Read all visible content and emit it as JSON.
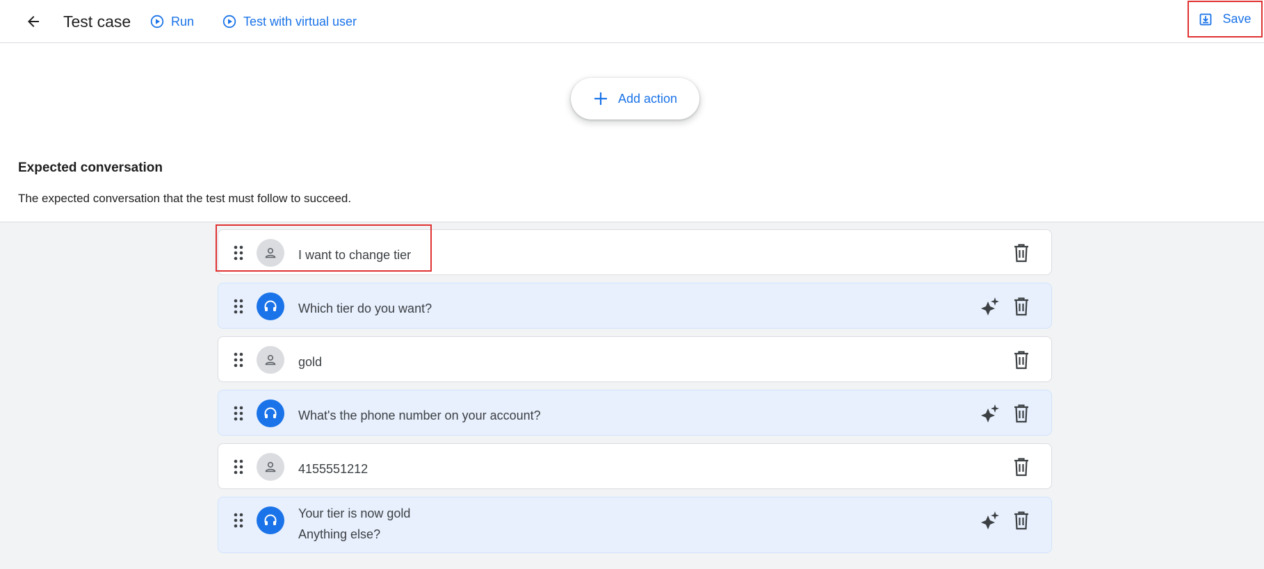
{
  "header": {
    "title": "Test case",
    "run_label": "Run",
    "virtual_user_label": "Test with virtual user",
    "save_label": "Save"
  },
  "add_action_label": "Add action",
  "section": {
    "title": "Expected conversation",
    "description": "The expected conversation that the test must follow to succeed."
  },
  "turns": [
    {
      "role": "user",
      "text": "I want to change tier"
    },
    {
      "role": "agent",
      "text": "Which tier do you want?"
    },
    {
      "role": "user",
      "text": "gold"
    },
    {
      "role": "agent",
      "text": "What's the phone number on your account?"
    },
    {
      "role": "user",
      "text": "4155551212"
    },
    {
      "role": "agent",
      "line1": "Your tier is now gold",
      "line2": "Anything else?"
    }
  ],
  "colors": {
    "accent": "#1a73e8",
    "agent_row_bg": "#e8f0fe",
    "highlight": "#e03131"
  }
}
